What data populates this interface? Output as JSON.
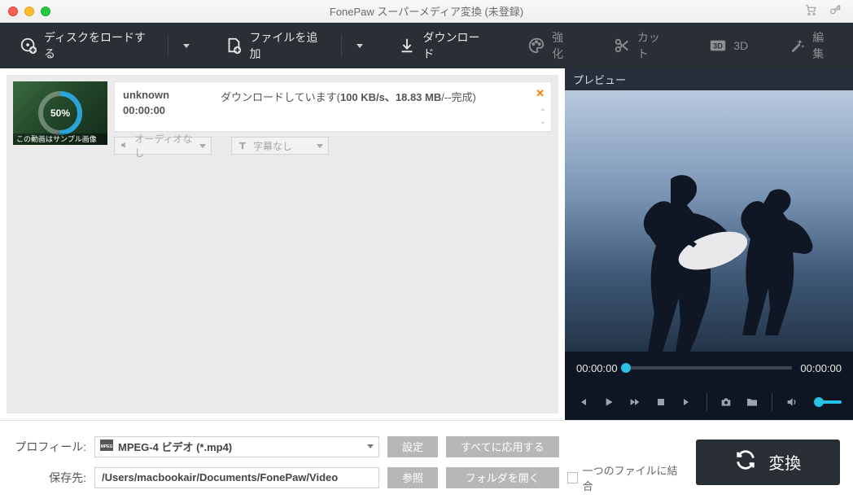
{
  "window": {
    "title": "FonePaw スーパーメディア変換 (未登録)"
  },
  "toolbar": {
    "load_disc": "ディスクをロードする",
    "add_file": "ファイルを追加",
    "download": "ダウンロード",
    "enhance": "強化",
    "cut": "カット",
    "threeD": "3D",
    "edit": "編集"
  },
  "item": {
    "name": "unknown",
    "duration": "00:00:00",
    "progress_pct": "50%",
    "thumb_caption": "この動画はサンプル画像",
    "status_prefix": "ダウンロードしています(",
    "status_speed": "100 KB/s、",
    "status_size": "18.83 MB",
    "status_suffix": "/--完成)",
    "audio_none": "オーディオなし",
    "subtitle_none": "字幕なし"
  },
  "preview": {
    "title": "プレビュー",
    "time_start": "00:00:00",
    "time_end": "00:00:00"
  },
  "bottom": {
    "profile_label": "プロフィール:",
    "profile_value": "MPEG-4 ビデオ (*.mp4)",
    "settings": "設定",
    "apply_all": "すべてに応用する",
    "save_label": "保存先:",
    "save_path": "/Users/macbookair/Documents/FonePaw/Video",
    "browse": "参照",
    "open_folder": "フォルダを開く",
    "merge_label": "一つのファイルに結合",
    "convert": "変換"
  }
}
